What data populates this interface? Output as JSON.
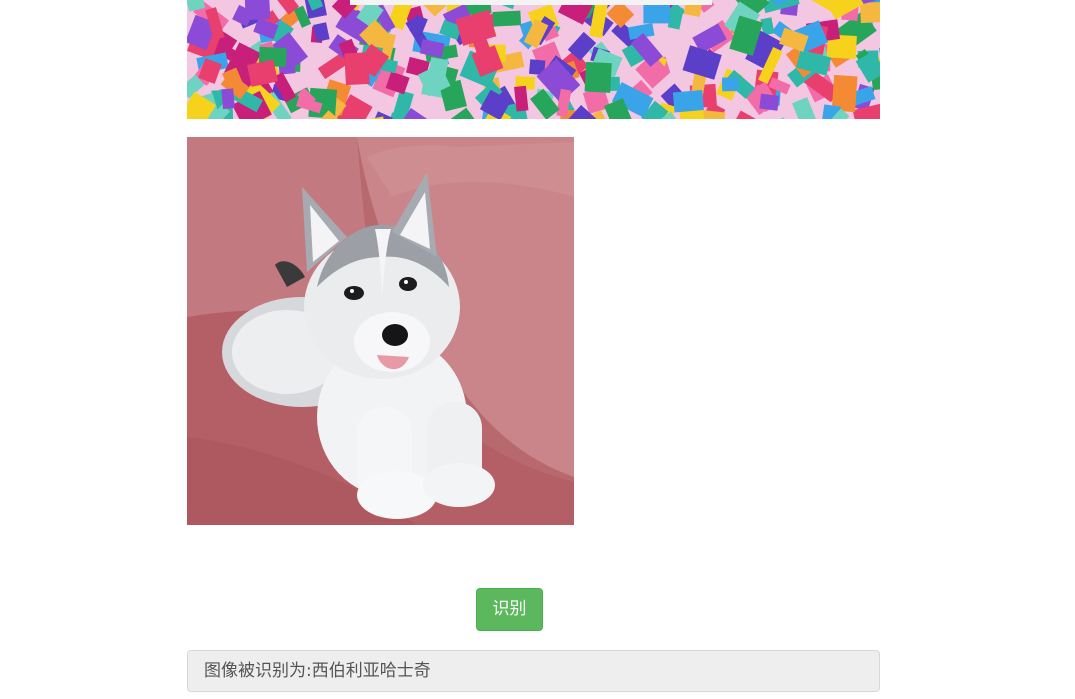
{
  "banner": {
    "image": "confetti-paper-banner"
  },
  "photo": {
    "image": "husky-puppy-on-pink-sofa"
  },
  "recognize_button": {
    "label": "识别",
    "color": "#5cb85c"
  },
  "result": {
    "text": "图像被识别为:西伯利亚哈士奇"
  }
}
